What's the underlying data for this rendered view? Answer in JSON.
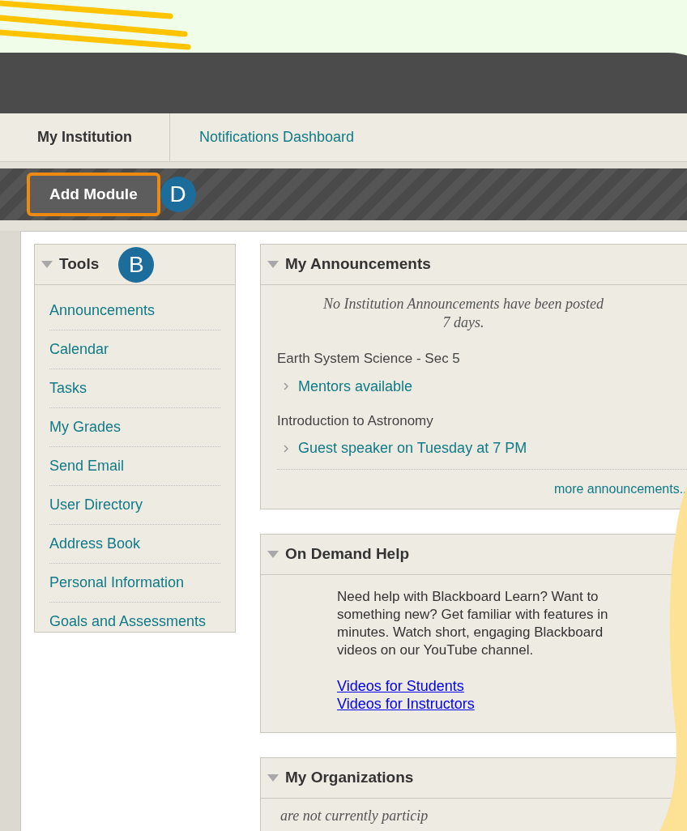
{
  "tabs": [
    {
      "label": "My Institution",
      "selected": true
    },
    {
      "label": "Notifications Dashboard",
      "selected": false
    }
  ],
  "add_module": {
    "label": "Add Module",
    "highlighted": true,
    "badge": "D"
  },
  "tools": {
    "title": "Tools",
    "badge": "B",
    "items": [
      "Announcements",
      "Calendar",
      "Tasks",
      "My Grades",
      "Send Email",
      "User Directory",
      "Address Book",
      "Personal Information",
      "Goals and Assessments"
    ]
  },
  "modules": [
    {
      "kind": "announcements",
      "title": "My Announcements",
      "notice_lines": [
        "No Institution Announcements have been posted",
        "7 days."
      ],
      "courses": [
        {
          "name": "Earth System Science - Sec 5",
          "items": [
            "Mentors available"
          ]
        },
        {
          "name": "Introduction to Astronomy",
          "items": [
            "Guest speaker on Tuesday at 7 PM"
          ]
        }
      ],
      "more_link": "more announcements..."
    },
    {
      "kind": "help",
      "title": "On Demand Help",
      "text_lines": [
        "Need help with Blackboard Learn? Want to",
        "something new? Get familiar with features in",
        "minutes. Watch short, engaging Blackboard",
        "videos on our YouTube channel."
      ],
      "links": [
        "Videos for Students",
        "Videos for Instructors"
      ]
    },
    {
      "kind": "organizations",
      "title": "My Organizations",
      "notice": "are not currently particip"
    }
  ]
}
